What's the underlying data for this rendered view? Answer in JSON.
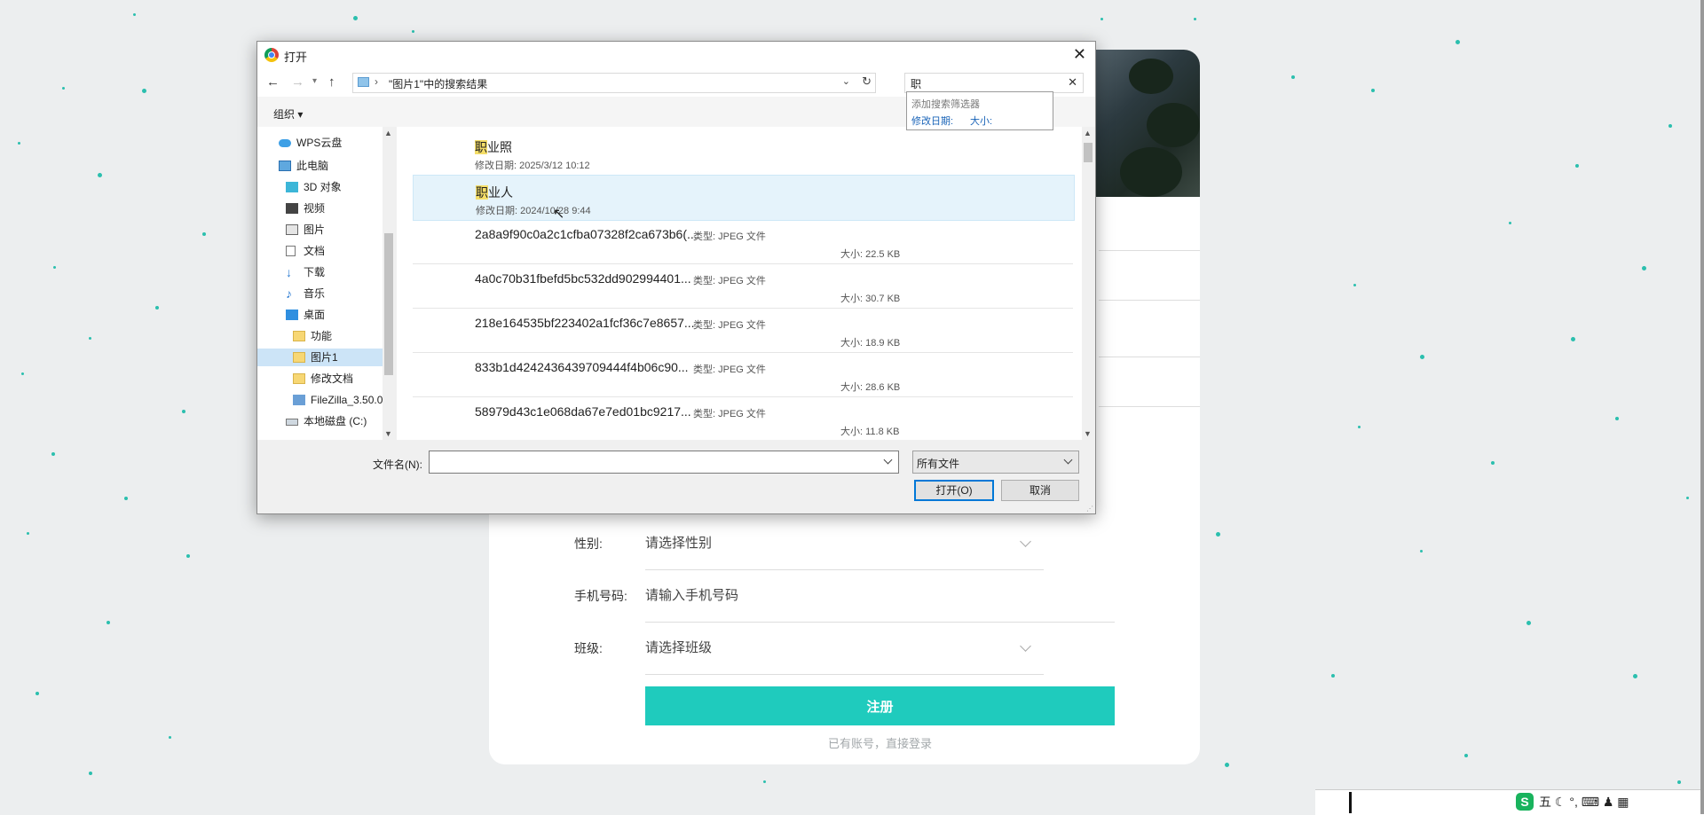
{
  "background_form": {
    "fields": [
      {
        "label": "性别:",
        "value": "请选择性别",
        "type": "select"
      },
      {
        "label": "手机号码:",
        "value": "请输入手机号码",
        "type": "input"
      },
      {
        "label": "班级:",
        "value": "请选择班级",
        "type": "select"
      }
    ],
    "register_button": "注册",
    "login_link": "已有账号，直接登录"
  },
  "dialog": {
    "title": "打开",
    "address_path": "\"图片1\"中的搜索结果",
    "search_value": "职",
    "toolbar_organize": "组织 ▾",
    "search_suggest": {
      "heading": "添加搜索筛选器",
      "filter_date": "修改日期:",
      "filter_size": "大小:"
    },
    "tree": [
      {
        "label": "WPS云盘",
        "icon": "cloud-icon"
      },
      {
        "label": "此电脑",
        "icon": "computer-icon"
      },
      {
        "label": "3D 对象",
        "icon": "cube-icon"
      },
      {
        "label": "视频",
        "icon": "video-icon"
      },
      {
        "label": "图片",
        "icon": "picture-icon"
      },
      {
        "label": "文档",
        "icon": "document-icon"
      },
      {
        "label": "下载",
        "icon": "download-icon"
      },
      {
        "label": "音乐",
        "icon": "music-icon"
      },
      {
        "label": "桌面",
        "icon": "desktop-icon"
      },
      {
        "label": "功能",
        "icon": "folder-icon"
      },
      {
        "label": "图片1",
        "icon": "folder-icon",
        "selected": true
      },
      {
        "label": "修改文档",
        "icon": "folder-icon"
      },
      {
        "label": "FileZilla_3.50.0",
        "icon": "app-icon"
      },
      {
        "label": "本地磁盘 (C:)",
        "icon": "drive-icon"
      }
    ],
    "items": [
      {
        "match": "职",
        "rest": "业照",
        "meta": "修改日期: 2025/3/12 10:12"
      },
      {
        "match": "职",
        "rest": "业人",
        "meta": "修改日期: 2024/10/28 9:44",
        "highlighted": true
      },
      {
        "name": "2a8a9f90c0a2c1cfba07328f2ca673b6(...",
        "type": "类型: JPEG 文件",
        "size": "大小: 22.5 KB"
      },
      {
        "name": "4a0c70b31fbefd5bc532dd902994401...",
        "type": "类型: JPEG 文件",
        "size": "大小: 30.7 KB"
      },
      {
        "name": "218e164535bf223402a1fcf36c7e8657...",
        "type": "类型: JPEG 文件",
        "size": "大小: 18.9 KB"
      },
      {
        "name": "833b1d4242436439709444f4b06c90...",
        "type": "类型: JPEG 文件",
        "size": "大小: 28.6 KB"
      },
      {
        "name": "58979d43c1e068da67e7ed01bc9217...",
        "type": "类型: JPEG 文件",
        "size": "大小: 11.8 KB"
      }
    ],
    "filename_label": "文件名(N):",
    "filename_value": "",
    "filetype_value": "所有文件",
    "open_button": "打开(O)",
    "cancel_button": "取消"
  },
  "ime": {
    "logo": "S",
    "mode": "五"
  },
  "colors": {
    "accent": "#1fcbbd",
    "dot": "#2bbfae",
    "match_highlight": "#f5de68",
    "selection": "#cce4f7"
  }
}
